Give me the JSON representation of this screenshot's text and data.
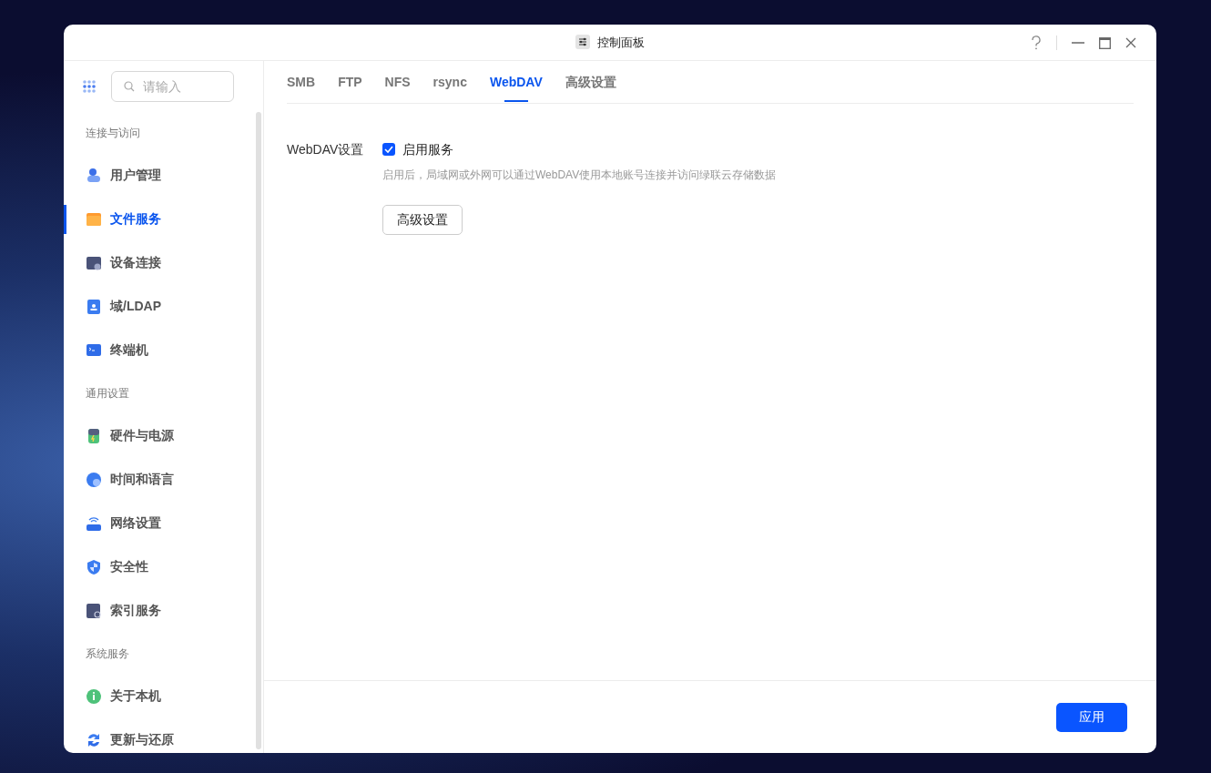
{
  "window": {
    "title": "控制面板"
  },
  "sidebar": {
    "search": {
      "placeholder": "请输入"
    },
    "sections": [
      {
        "title": "连接与访问",
        "items": [
          {
            "label": "用户管理",
            "selected": false
          },
          {
            "label": "文件服务",
            "selected": true
          },
          {
            "label": "设备连接",
            "selected": false
          },
          {
            "label": "域/LDAP",
            "selected": false
          },
          {
            "label": "终端机",
            "selected": false
          }
        ]
      },
      {
        "title": "通用设置",
        "items": [
          {
            "label": "硬件与电源",
            "selected": false
          },
          {
            "label": "时间和语言",
            "selected": false
          },
          {
            "label": "网络设置",
            "selected": false
          },
          {
            "label": "安全性",
            "selected": false
          },
          {
            "label": "索引服务",
            "selected": false
          }
        ]
      },
      {
        "title": "系统服务",
        "items": [
          {
            "label": "关于本机",
            "selected": false
          },
          {
            "label": "更新与还原",
            "selected": false
          }
        ]
      }
    ]
  },
  "tabs": [
    {
      "label": "SMB",
      "selected": false
    },
    {
      "label": "FTP",
      "selected": false
    },
    {
      "label": "NFS",
      "selected": false
    },
    {
      "label": "rsync",
      "selected": false
    },
    {
      "label": "WebDAV",
      "selected": true
    },
    {
      "label": "高级设置",
      "selected": false
    }
  ],
  "settings": {
    "label": "WebDAV设置",
    "enable": {
      "label": "启用服务",
      "checked": true
    },
    "hint": "启用后，局域网或外网可以通过WebDAV使用本地账号连接并访问绿联云存储数据",
    "button": "高级设置"
  },
  "footer": {
    "apply": "应用"
  }
}
